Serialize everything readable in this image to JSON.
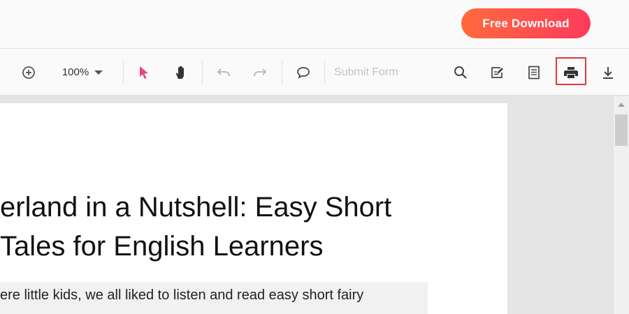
{
  "header": {
    "free_download_label": "Free Download"
  },
  "toolbar": {
    "zoom_value": "100%",
    "submit_form_label": "Submit Form",
    "icons": [
      "zoom-in-icon",
      "chevron-down-icon",
      "pointer-icon",
      "hand-icon",
      "undo-icon",
      "redo-icon",
      "comment-icon",
      "search-icon",
      "edit-annotation-icon",
      "page-view-icon",
      "print-icon",
      "download-icon"
    ],
    "colors": {
      "pointer_active": "#e8457a",
      "print_highlight": "#e03a3a"
    }
  },
  "document": {
    "title_lines": [
      "erland in a Nutshell: Easy Short",
      "Tales for English Learners"
    ],
    "paragraph_line": "ere little kids, we all liked to listen and read easy short fairy"
  },
  "colors": {
    "brand_gradient_start": "#ff6a3d",
    "brand_gradient_end": "#ff3b5c"
  }
}
